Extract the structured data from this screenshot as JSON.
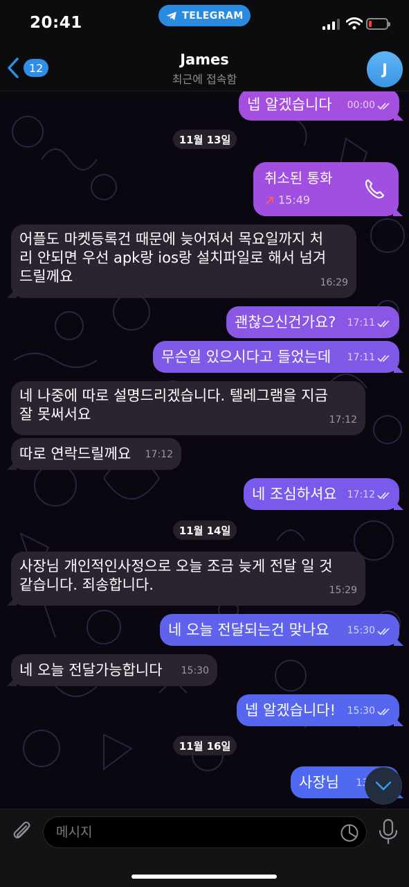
{
  "status_bar": {
    "time": "20:41",
    "telegram_label": "TELEGRAM"
  },
  "header": {
    "back_badge": "12",
    "title": "James",
    "subtitle": "최근에 접속함",
    "avatar_initial": "J"
  },
  "dates": [
    "11월 13일",
    "11월 14일",
    "11월 16일"
  ],
  "messages": [
    {
      "dir": "out",
      "text": "넵 알겠습니다",
      "time": "00:00",
      "read": true
    },
    {
      "dir": "out",
      "type": "call",
      "text": "취소된 통화",
      "time": "15:49"
    },
    {
      "dir": "in",
      "lines": [
        "어플도 마켓등록건 때문에 늦어져서 목요일까지 처",
        "리 안되면 우선 apk랑 ios랑 설치파일로 해서 넘겨",
        "드릴께요"
      ],
      "time": "16:29"
    },
    {
      "dir": "out",
      "text": "괜찮으신건가요?",
      "time": "17:11",
      "read": true
    },
    {
      "dir": "out",
      "text": "무슨일 있으시다고 들었는데",
      "time": "17:11",
      "read": true
    },
    {
      "dir": "in",
      "lines": [
        "네 나중에 따로 설명드리겠습니다. 텔레그램을 지금",
        "잘 못써서요"
      ],
      "time": "17:12"
    },
    {
      "dir": "in",
      "text": "따로 연락드릴께요",
      "time": "17:12"
    },
    {
      "dir": "out",
      "text": "네 조심하셔요",
      "time": "17:12",
      "read": true
    },
    {
      "dir": "in",
      "lines": [
        "사장님 개인적인사정으로 오늘 조금 늦게 전달 일 것",
        "같습니다. 죄송합니다."
      ],
      "time": "15:29"
    },
    {
      "dir": "out",
      "text": "네 오늘 전달되는건 맞나요",
      "time": "15:30",
      "read": true
    },
    {
      "dir": "in",
      "text": "네 오늘 전달가능합니다",
      "time": "15:30"
    },
    {
      "dir": "out",
      "text": "넵 알겠습니다!",
      "time": "15:30",
      "read": true
    },
    {
      "dir": "out",
      "text": "사장님",
      "time": "13:"
    }
  ],
  "input": {
    "placeholder": "메시지"
  },
  "colors": {
    "out_top": "#a44fdf",
    "out_bottom": "#5867ee",
    "incoming": "#2a2430",
    "accent": "#2f8fe8"
  }
}
